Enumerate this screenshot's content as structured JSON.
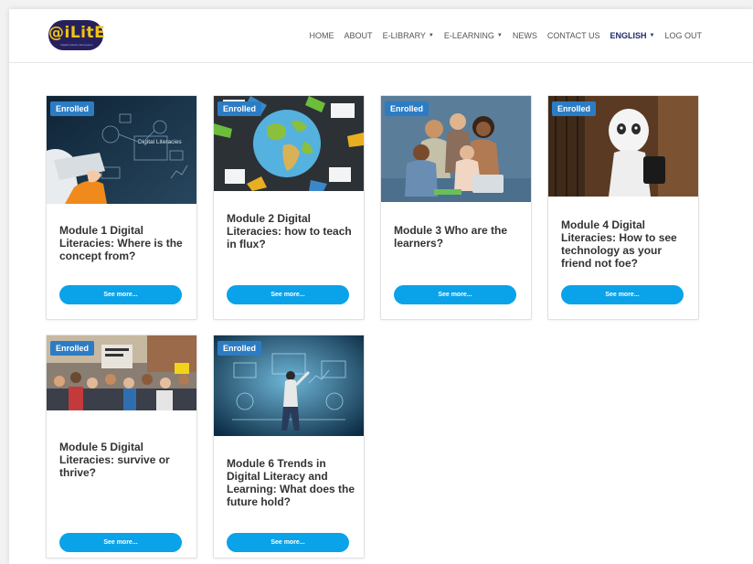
{
  "logo": {
    "text": "@iLitE",
    "subtitle": "Digital Literacy Ecosystem"
  },
  "nav": [
    {
      "label": "HOME",
      "caret": false,
      "active": false
    },
    {
      "label": "ABOUT",
      "caret": false,
      "active": false
    },
    {
      "label": "E-LIBRARY",
      "caret": true,
      "active": false
    },
    {
      "label": "E-LEARNING",
      "caret": true,
      "active": false
    },
    {
      "label": "NEWS",
      "caret": false,
      "active": false
    },
    {
      "label": "CONTACT US",
      "caret": false,
      "active": false
    },
    {
      "label": "ENGLISH",
      "caret": true,
      "active": true
    },
    {
      "label": "LOG OUT",
      "caret": false,
      "active": false
    }
  ],
  "modules": [
    {
      "badge": "Enrolled",
      "title": "Module 1 Digital Literacies: Where is the concept from?",
      "button": "See more...",
      "image_text": "Digital Literacies"
    },
    {
      "badge": "Enrolled",
      "title": "Module 2 Digital Literacies: how to teach in flux?",
      "button": "See more..."
    },
    {
      "badge": "Enrolled",
      "title": "Module 3 Who are the learners?",
      "button": "See more..."
    },
    {
      "badge": "Enrolled",
      "title": "Module 4 Digital Literacies: How to see technology as your friend not foe?",
      "button": "See more..."
    },
    {
      "badge": "Enrolled",
      "title": "Module 5 Digital Literacies: survive or thrive?",
      "button": "See more..."
    },
    {
      "badge": "Enrolled",
      "title": "Module 6 Trends in Digital Literacy and Learning: What does the future hold?",
      "button": "See more..."
    }
  ],
  "colors": {
    "accent": "#0aa2e8",
    "badge": "#2c7cc4",
    "logo_bg": "#26205c",
    "logo_text": "#f1c40f"
  }
}
